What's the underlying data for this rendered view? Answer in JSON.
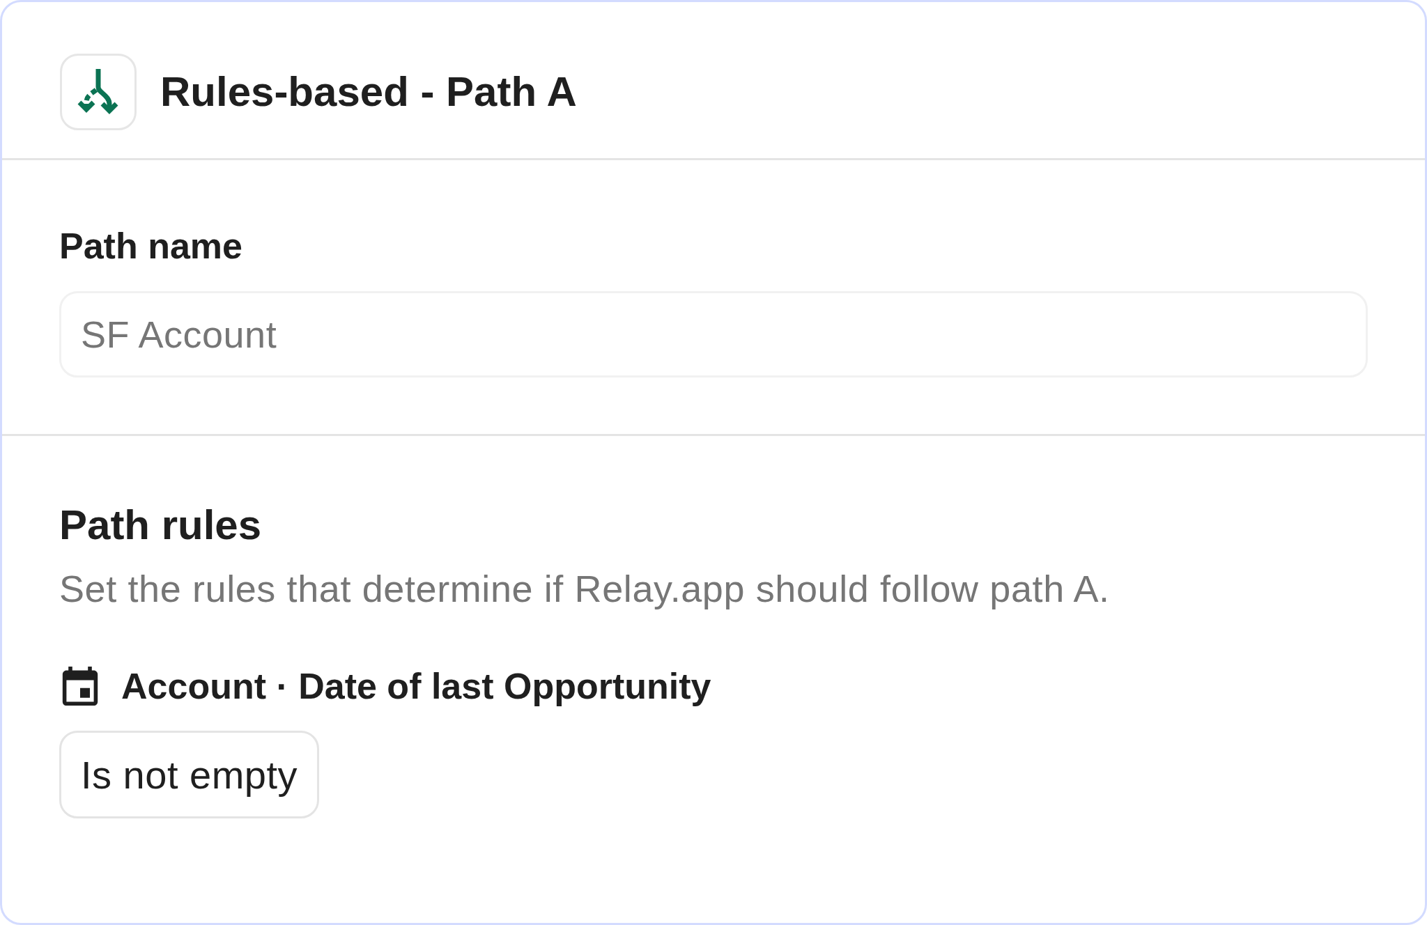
{
  "header": {
    "title": "Rules-based - Path A"
  },
  "path_name": {
    "label": "Path name",
    "placeholder": "SF Account"
  },
  "path_rules": {
    "title": "Path rules",
    "description": "Set the rules that determine if Relay.app should follow path A.",
    "rules": [
      {
        "kind": "date",
        "field": "Account · Date of last Opportunity",
        "condition": "Is not empty"
      }
    ]
  }
}
